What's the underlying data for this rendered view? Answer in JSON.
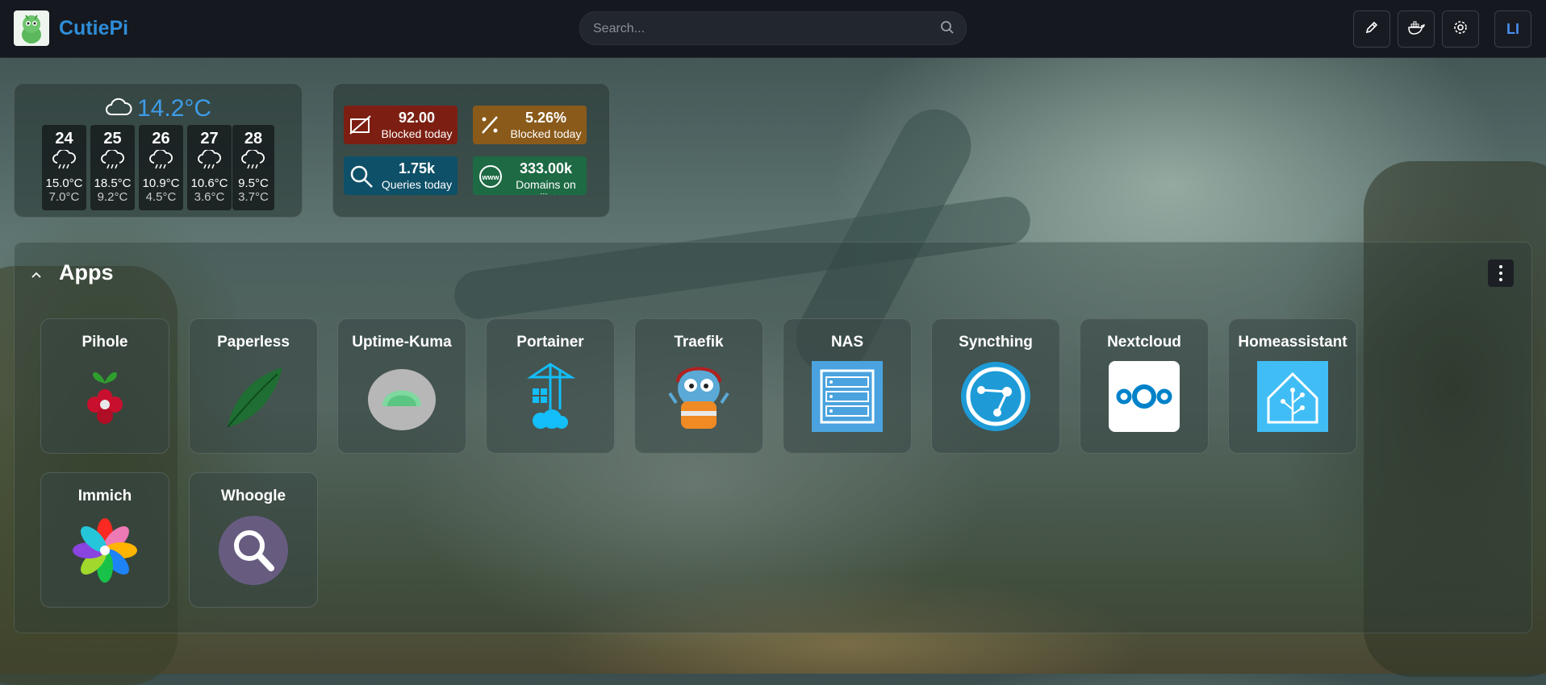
{
  "header": {
    "brand": "CutiePi",
    "search_placeholder": "Search...",
    "buttons": [
      "edit-icon",
      "docker-icon",
      "gear-icon"
    ],
    "user_initials": "LI"
  },
  "weather": {
    "current_temp": "14.2°C",
    "days": [
      {
        "day": "24",
        "high": "15.0°C",
        "low": "7.0°C"
      },
      {
        "day": "25",
        "high": "18.5°C",
        "low": "9.2°C"
      },
      {
        "day": "26",
        "high": "10.9°C",
        "low": "4.5°C"
      },
      {
        "day": "27",
        "high": "10.6°C",
        "low": "3.6°C"
      },
      {
        "day": "28",
        "high": "9.5°C",
        "low": "3.7°C"
      }
    ]
  },
  "pihole": [
    {
      "value": "92.00",
      "label": "Blocked today",
      "color": "#7c1f12"
    },
    {
      "value": "5.26%",
      "label": "Blocked today",
      "color": "#8a5a1a"
    },
    {
      "value": "1.75k",
      "label": "Queries today",
      "color": "#0e5068"
    },
    {
      "value": "333.00k",
      "label": "Domains on adlists",
      "color": "#1d6a44"
    }
  ],
  "apps": {
    "title": "Apps",
    "items": [
      {
        "name": "Pihole"
      },
      {
        "name": "Paperless"
      },
      {
        "name": "Uptime-Kuma"
      },
      {
        "name": "Portainer"
      },
      {
        "name": "Traefik"
      },
      {
        "name": "NAS"
      },
      {
        "name": "Syncthing"
      },
      {
        "name": "Nextcloud"
      },
      {
        "name": "Homeassistant"
      },
      {
        "name": "Immich"
      },
      {
        "name": "Whoogle"
      }
    ]
  }
}
